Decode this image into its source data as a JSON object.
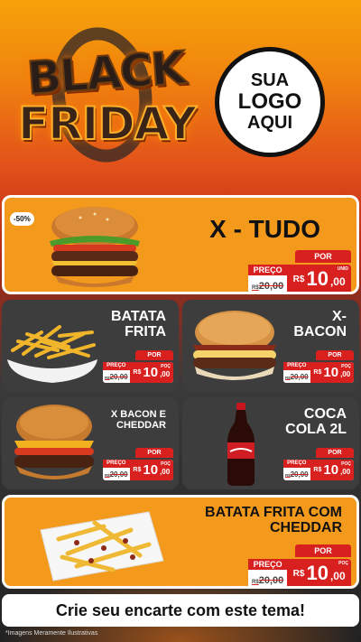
{
  "header": {
    "black": "BLACK",
    "friday": "FRIDAY",
    "logo": {
      "line1": "SUA",
      "line2": "LOGO",
      "line3": "AQUI"
    }
  },
  "products": [
    {
      "id": "x-tudo",
      "name": "X - TUDO",
      "badge": "-50%",
      "por": "POR",
      "preco": "PREÇO",
      "old_prefix": "R$",
      "old_value": "20,00",
      "currency": "R$",
      "price_int": "10",
      "price_cents": ",00",
      "unit": "UNID"
    },
    {
      "id": "batata-frita",
      "name_lines": [
        "BATATA",
        "FRITA"
      ],
      "por": "POR",
      "preco": "PREÇO",
      "old_prefix": "R$",
      "old_value": "20,00",
      "currency": "R$",
      "price_int": "10",
      "price_cents": ",00",
      "unit": "POÇ"
    },
    {
      "id": "x-bacon",
      "name_lines": [
        "X-",
        "BACON"
      ],
      "por": "POR",
      "preco": "PREÇO",
      "old_prefix": "R$",
      "old_value": "20,00",
      "currency": "R$",
      "price_int": "10",
      "price_cents": ",00",
      "unit": "POÇ"
    },
    {
      "id": "x-bacon-cheddar",
      "name_lines": [
        "X BACON E",
        "CHEDDAR"
      ],
      "por": "POR",
      "preco": "PREÇO",
      "old_prefix": "R$",
      "old_value": "20,00",
      "currency": "R$",
      "price_int": "10",
      "price_cents": ",00",
      "unit": "POÇ"
    },
    {
      "id": "coca-cola",
      "name_lines": [
        "COCA",
        "COLA 2L"
      ],
      "por": "POR",
      "preco": "PREÇO",
      "old_prefix": "R$",
      "old_value": "20,00",
      "currency": "R$",
      "price_int": "10",
      "price_cents": ",00",
      "unit": "POÇ"
    },
    {
      "id": "batata-cheddar",
      "name_lines": [
        "BATATA FRITA COM",
        "CHEDDAR"
      ],
      "por": "POR",
      "preco": "PREÇO",
      "old_prefix": "R$",
      "old_value": "20,00",
      "currency": "R$",
      "price_int": "10",
      "price_cents": ",00",
      "unit": "POÇ"
    }
  ],
  "footer": {
    "cta": "Crie seu encarte com este tema!",
    "disclaimer": "*Imagens Meramente Ilustrativas"
  },
  "colors": {
    "orange": "#f39a1c",
    "gray": "#3d3d3d",
    "red": "#d8201f"
  },
  "icons": [
    "burger-image",
    "fries-image",
    "bacon-burger-image",
    "cheddar-burger-image",
    "coca-cola-bottle-image",
    "cheddar-fries-image"
  ]
}
